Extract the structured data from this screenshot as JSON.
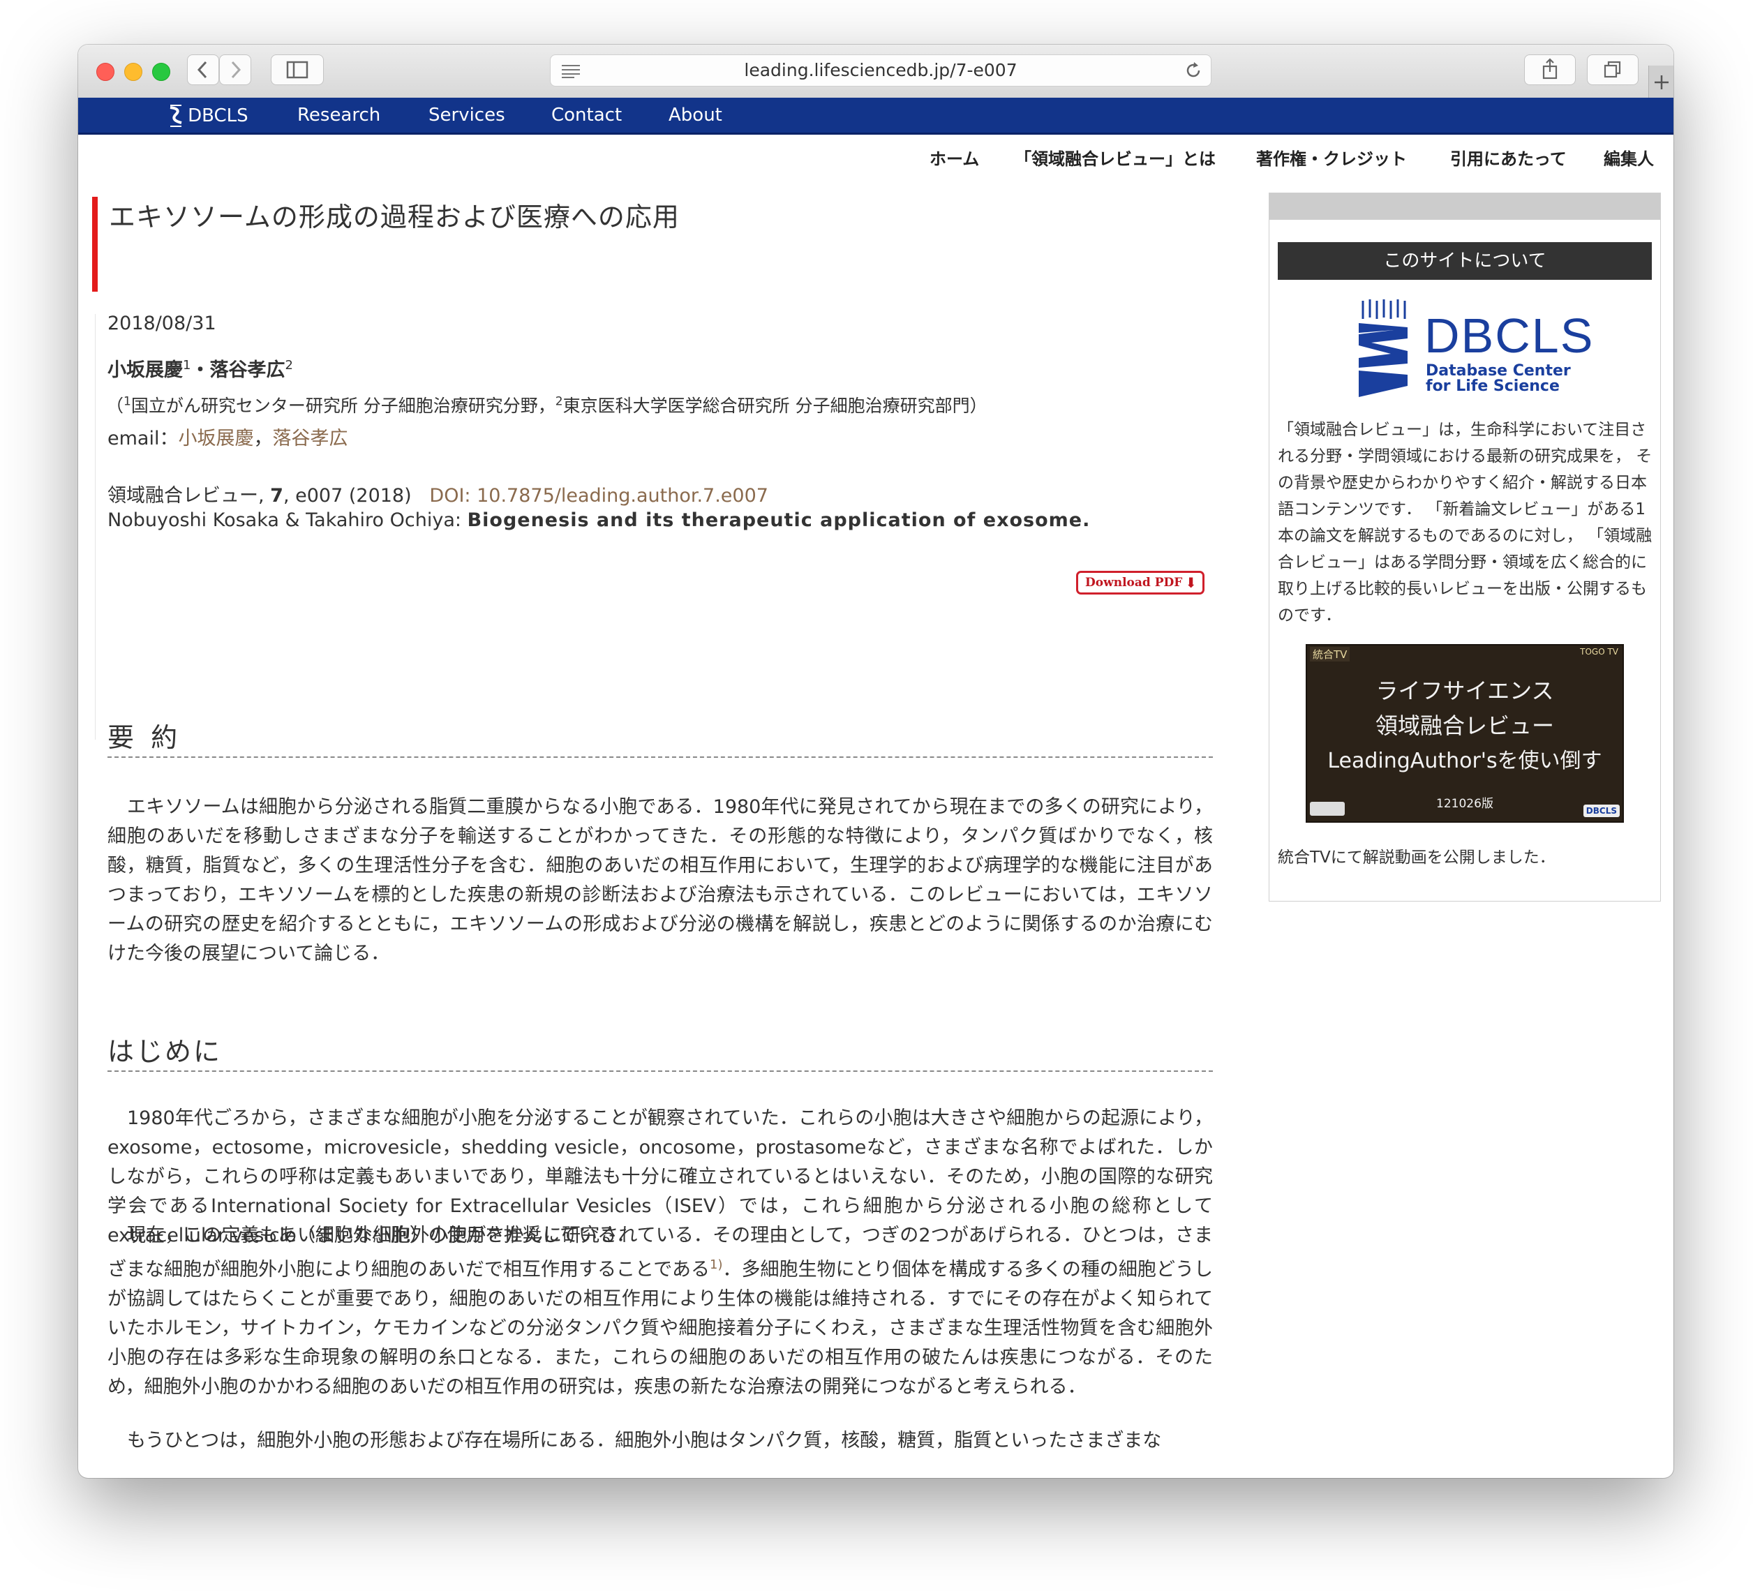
{
  "browser": {
    "url": "leading.lifesciencedb.jp/7-e007"
  },
  "topnav": {
    "brand": "DBCLS",
    "items": [
      "Research",
      "Services",
      "Contact",
      "About"
    ]
  },
  "subnav": {
    "items": [
      "ホーム",
      "「領域融合レビュー」とは",
      "著作権・クレジット",
      "引用にあたって",
      "編集人"
    ]
  },
  "article": {
    "title": "エキソソームの形成の過程および医療への応用",
    "date": "2018/08/31",
    "author1": "小坂展慶",
    "author1_sup": "1",
    "author_sep": "・",
    "author2": "落谷孝広",
    "author2_sup": "2",
    "affil_open": "（",
    "affil1_sup": "1",
    "affil1": "国立がん研究センター研究所 分子細胞治療研究分野，",
    "affil2_sup": "2",
    "affil2": "東京医科大学医学総合研究所 分子細胞治療研究部門）",
    "email_label": "email：",
    "email_link1": "小坂展慶",
    "email_sep": "，",
    "email_link2": "落谷孝広",
    "citation_prefix": "領域融合レビュー, ",
    "citation_vol": "7",
    "citation_rest": ", e007 (2018)",
    "doi": "DOI: 10.7875/leading.author.7.e007",
    "english_authors": "Nobuyoshi Kosaka & Takahiro Ochiya: ",
    "english_title": "Biogenesis and its therapeutic application of exosome.",
    "pdf_button": "Download PDF",
    "pdf_arrow": "⬇"
  },
  "sections": {
    "summary_heading": "要 約",
    "summary_text": "エキソソームは細胞から分泌される脂質二重膜からなる小胞である．1980年代に発見されてから現在までの多くの研究により，細胞のあいだを移動しさまざまな分子を輸送することがわかってきた．その形態的な特徴により，タンパク質ばかりでなく，核酸，糖質，脂質など，多くの生理活性分子を含む．細胞のあいだの相互作用において，生理学的および病理学的な機能に注目があつまっており，エキソソームを標的とした疾患の新規の診断法および治療法も示されている．このレビューにおいては，エキソソームの研究の歴史を紹介するとともに，エキソソームの形成および分泌の機構を解説し，疾患とどのように関係するのか治療にむけた今後の展望について論じる．",
    "intro_heading": "はじめに",
    "intro_p1": "1980年代ごろから，さまざまな細胞が小胞を分泌することが観察されていた．これらの小胞は大きさや細胞からの起源により，exosome，ectosome，microvesicle，shedding vesicle，oncosome，prostasomeなど，さまざまな名称でよばれた．しかしながら，これらの呼称は定義もあいまいであり，単離法も十分に確立されているとはいえない．そのため，小胞の国際的な研究学会であるInternational Society for Extracellular Vesicles（ISEV）では，これら細胞から分泌される小胞の総称としてextracellular vesicle（細胞外小胞）の使用を推奨している．",
    "intro_p2a": "現在，この定義もあいまいな細胞外小胞がさかんに研究されている．その理由として，つぎの2つがあげられる．ひとつは，さまざまな細胞が細胞外小胞により細胞のあいだで相互作用することである",
    "intro_p2_ref": "1)",
    "intro_p2b": "．多細胞生物にとり個体を構成する多くの種の細胞どうしが協調してはたらくことが重要であり，細胞のあいだの相互作用により生体の機能は維持される．すでにその存在がよく知られていたホルモン，サイトカイン，ケモカインなどの分泌タンパク質や細胞接着分子にくわえ，さまざまな生理活性物質を含む細胞外小胞の存在は多彩な生命現象の解明の糸口となる．また，これらの細胞のあいだの相互作用の破たんは疾患につながる．そのため，細胞外小胞のかかわる細胞のあいだの相互作用の研究は，疾患の新たな治療法の開発につながると考えられる．",
    "intro_p3": "もうひとつは，細胞外小胞の形態および存在場所にある．細胞外小胞はタンパク質，核酸，糖質，脂質といったさまざまな"
  },
  "sidebar": {
    "heading": "このサイトについて",
    "logo_text": "DBCLS",
    "logo_sub1": "Database Center",
    "logo_sub2": "for Life Science",
    "description": "「領域融合レビュー」は，生命科学において注目される分野・学問領域における最新の研究成果を， その背景や歴史からわかりやすく紹介・解説する日本語コンテンツです． 「新着論文レビュー」がある1本の論文を解説するものであるのに対し， 「領域融合レビュー」はある学問分野・領域を広く総合的に取り上げる比較的長いレビューを出版・公開するものです．",
    "video_corner_left": "統合TV",
    "video_corner_right": "TOGO TV",
    "video_line1": "ライフサイエンス",
    "video_line2": "領域融合レビュー",
    "video_line3": "LeadingAuthor'sを使い倒す",
    "video_version": "121026版",
    "video_badge": "DBCLS",
    "footer": "統合TVにて解説動画を公開しました．"
  },
  "colors": {
    "nav_blue": "#12348a",
    "accent_red": "#e31b1b",
    "link_brown": "#8a6a4d",
    "sidebar_heading_bg": "#333333"
  }
}
